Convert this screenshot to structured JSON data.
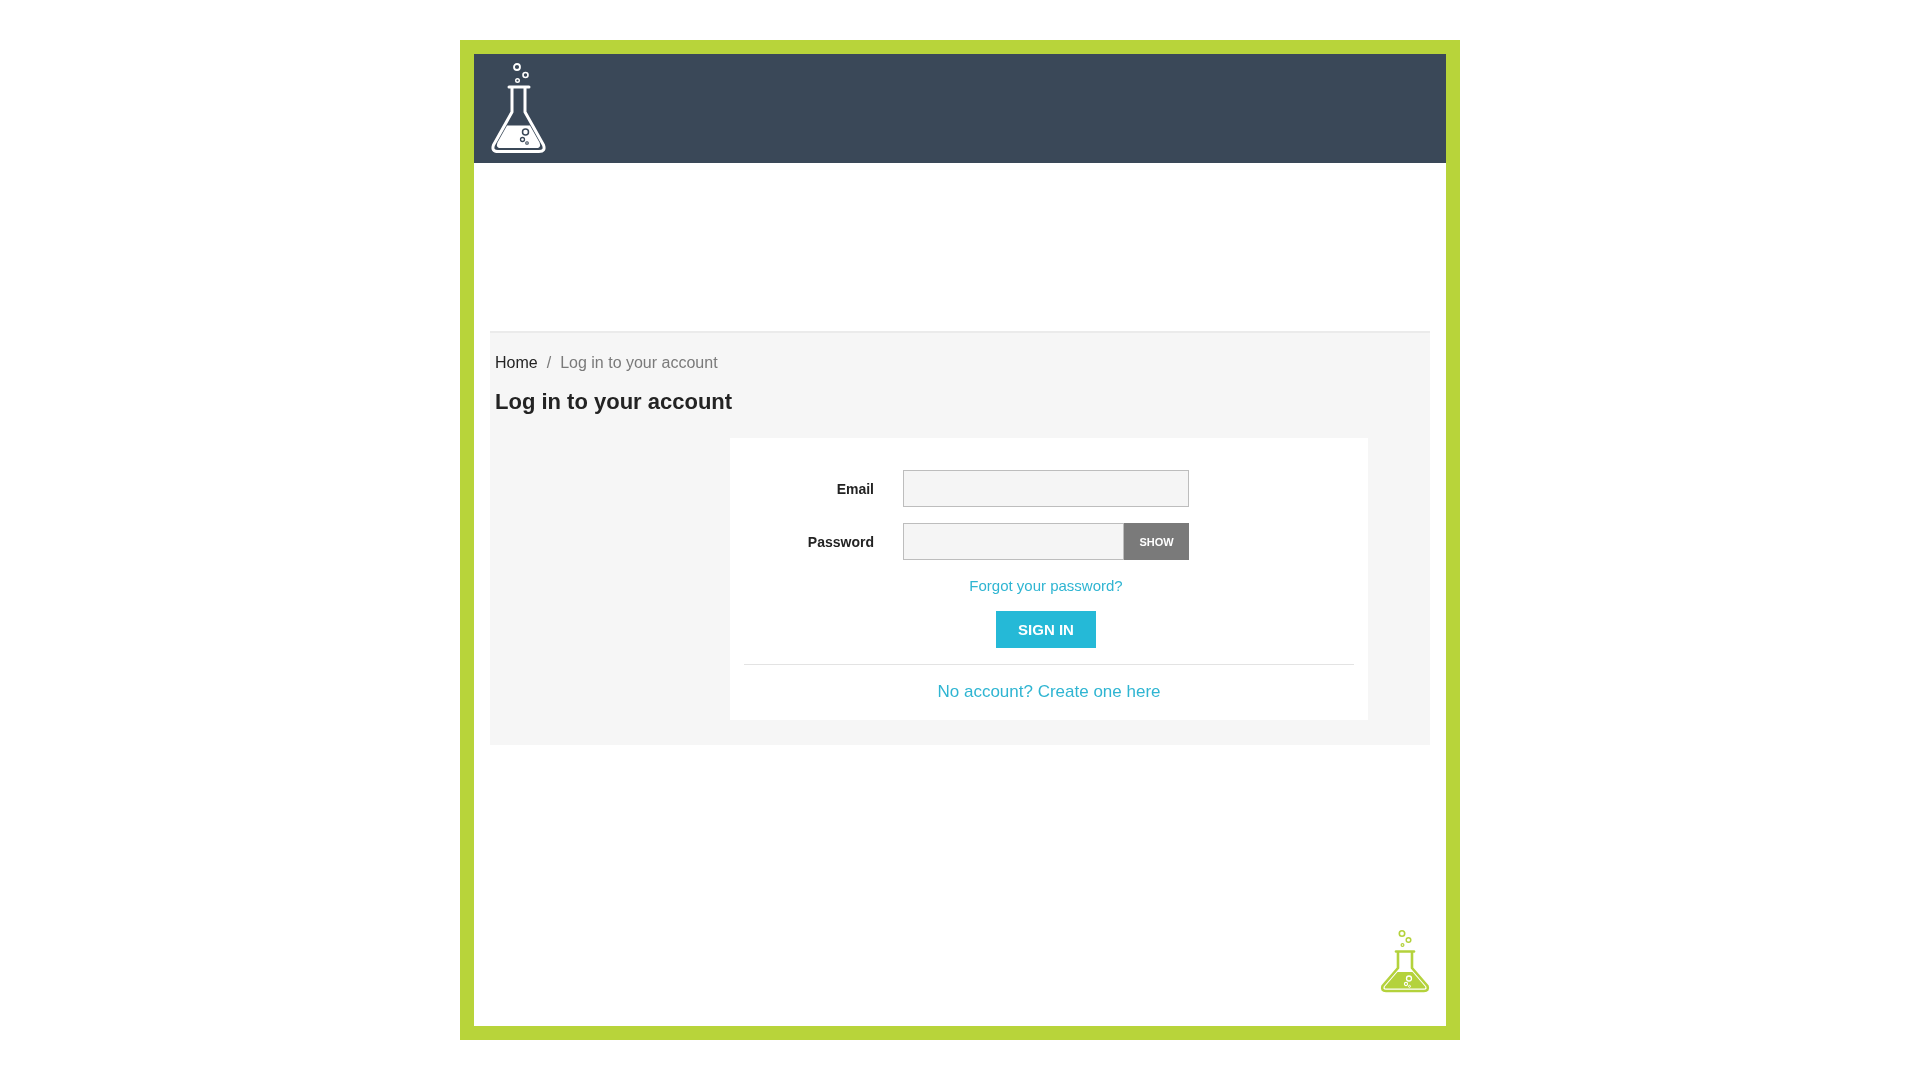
{
  "breadcrumb": {
    "separator": "/",
    "items": [
      {
        "label": "Home",
        "current": false
      },
      {
        "label": "Log in to your account",
        "current": true
      }
    ]
  },
  "page_title": "Log in to your account",
  "login_form": {
    "fields": [
      {
        "kind": "email",
        "label": "Email"
      },
      {
        "kind": "password",
        "label": "Password",
        "button": "SHOW"
      }
    ],
    "forgot_link": "Forgot your password?",
    "submit_button": "SIGN IN",
    "signup_link": "No account? Create one here"
  }
}
